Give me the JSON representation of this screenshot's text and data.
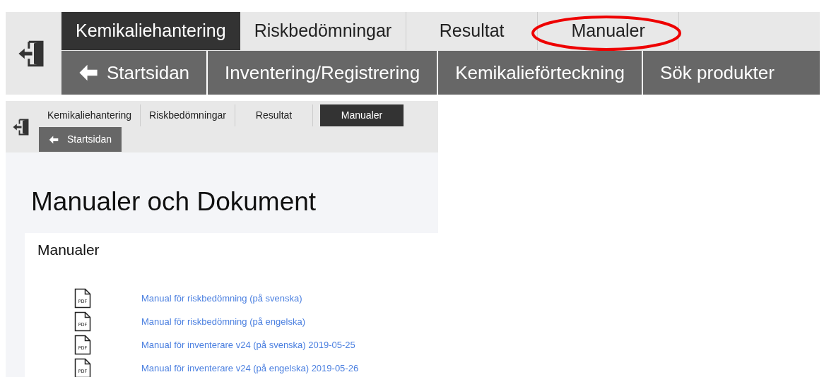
{
  "top_nav": {
    "tabs": [
      {
        "label": "Kemikaliehantering",
        "selected": true,
        "highlighted": false
      },
      {
        "label": "Riskbedömningar",
        "selected": false,
        "highlighted": false
      },
      {
        "label": "Resultat",
        "selected": false,
        "highlighted": false
      },
      {
        "label": "Manualer",
        "selected": false,
        "highlighted": true
      }
    ],
    "subnav": [
      {
        "label": "Startsidan",
        "kind": "back"
      },
      {
        "label": "Inventering/Registrering",
        "kind": "link"
      },
      {
        "label": "Kemikalieförteckning",
        "kind": "link"
      },
      {
        "label": "Sök produkter",
        "kind": "link"
      }
    ]
  },
  "page": {
    "tabs": [
      {
        "label": "Kemikaliehantering",
        "selected": false
      },
      {
        "label": "Riskbedömningar",
        "selected": false
      },
      {
        "label": "Resultat",
        "selected": false
      },
      {
        "label": "Manualer",
        "selected": true
      }
    ],
    "subnav": [
      {
        "label": "Startsidan",
        "kind": "back"
      }
    ],
    "heading": "Manualer och Dokument",
    "section": {
      "title": "Manualer",
      "documents": [
        {
          "icon_label": "PDF",
          "title": "Manual för riskbedömning (på svenska)"
        },
        {
          "icon_label": "PDF",
          "title": "Manual för riskbedömning (på engelska)"
        },
        {
          "icon_label": "PDF",
          "title": "Manual för inventerare v24 (på svenska) 2019-05-25"
        },
        {
          "icon_label": "PDF",
          "title": "Manual för inventerare v24 (på engelska) 2019-05-26"
        }
      ]
    }
  }
}
